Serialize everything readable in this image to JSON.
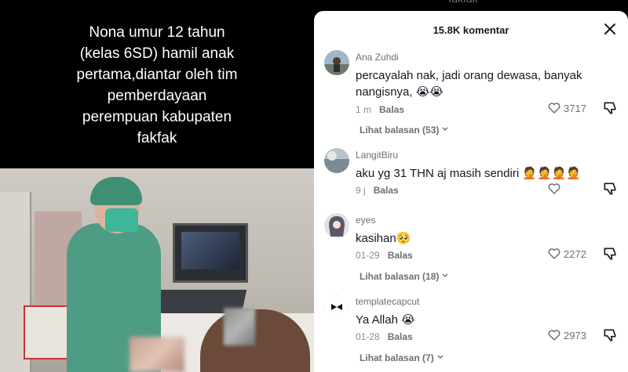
{
  "video": {
    "caption_lines": [
      "Nona umur 12 tahun",
      "(kelas 6SD) hamil anak",
      "pertama,diantar oleh tim",
      "pemberdayaan",
      "perempuan kabupaten",
      "fakfak"
    ]
  },
  "panel": {
    "peek_text": "fakfak",
    "title": "15.8K komentar",
    "close_icon": "close-icon"
  },
  "comments": [
    {
      "user": "Ana Zuhdi",
      "text": "percayalah nak, jadi orang dewasa, banyak nangisnya, 😭😭",
      "time": "1 m",
      "reply_label": "Balas",
      "likes": "3717",
      "view_replies": "Lihat balasan (53)"
    },
    {
      "user": "LangitBiru",
      "text": "aku yg 31 THN aj masih sendiri 🤦🤦🤦🤦",
      "time": "9 j",
      "reply_label": "Balas",
      "likes": ""
    },
    {
      "user": "eyes",
      "text": "kasihan🥺",
      "time": "01-29",
      "reply_label": "Balas",
      "likes": "2272",
      "view_replies": "Lihat balasan (18)"
    },
    {
      "user": "templatecapcut",
      "text": "Ya Allah 😭",
      "time": "01-28",
      "reply_label": "Balas",
      "likes": "2973",
      "view_replies": "Lihat balasan (7)"
    }
  ],
  "colors": {
    "panel_bg": "#ffffff",
    "text_primary": "#161823",
    "text_secondary": "#8a8b91"
  }
}
